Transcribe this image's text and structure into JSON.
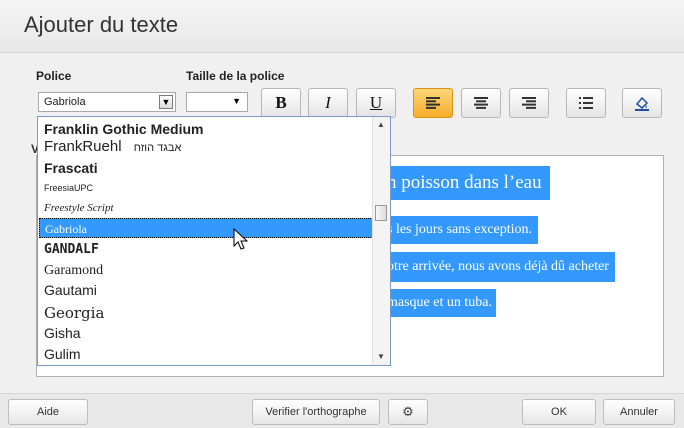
{
  "dialog": {
    "title": "Ajouter du texte"
  },
  "font_section": {
    "label": "Police",
    "selected": "Gabriola"
  },
  "size_section": {
    "label": "Taille de la police",
    "value": ""
  },
  "toolbar": {
    "bold_label": "B",
    "italic_label": "I",
    "underline_label": "U",
    "active_button": "align-left"
  },
  "font_list": {
    "items": [
      {
        "label": "Franklin Gothic Medium"
      },
      {
        "label": "FrankRuehl",
        "extra": "אבגד הוזח"
      },
      {
        "label": "Frascati"
      },
      {
        "label": "FreesiaUPC"
      },
      {
        "label": "Freestyle Script"
      },
      {
        "label": "Gabriola"
      },
      {
        "label": "GANDALF"
      },
      {
        "label": "Garamond"
      },
      {
        "label": "Gautami"
      },
      {
        "label": "Georgia"
      },
      {
        "label": "Gisha"
      },
      {
        "label": "Gulim"
      }
    ],
    "selected_index": 5
  },
  "editor": {
    "hidden_label_fragment": "V",
    "lines": [
      "n poisson dans l’eau",
      "s les jours sans exception.",
      "otre arrivée, nous avons déjà dû acheter",
      "masque et un tuba."
    ]
  },
  "footer": {
    "help": "Aide",
    "spellcheck": "Verifier l'orthographe",
    "ok": "OK",
    "cancel": "Annuler"
  },
  "colors": {
    "selection": "#3399ff",
    "active_button": "#f6ad2b"
  }
}
